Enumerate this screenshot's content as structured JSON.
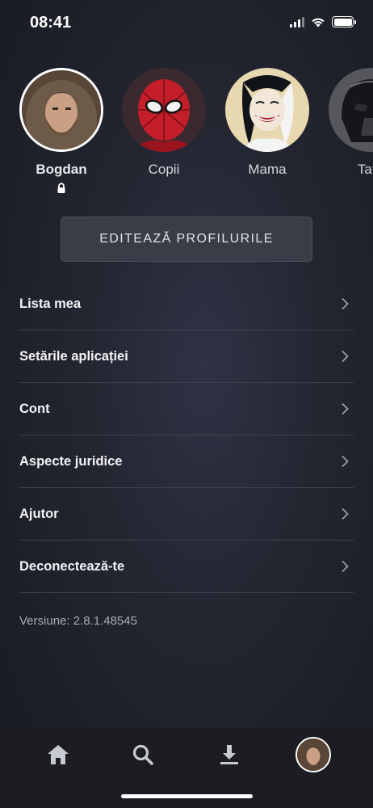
{
  "status": {
    "time": "08:41"
  },
  "profiles": [
    {
      "name": "Bogdan",
      "locked": true,
      "active": true
    },
    {
      "name": "Copii",
      "locked": false,
      "active": false
    },
    {
      "name": "Mama",
      "locked": false,
      "active": false
    },
    {
      "name": "Tata",
      "locked": false,
      "active": false
    }
  ],
  "edit_profiles_label": "EDITEAZĂ PROFILURILE",
  "menu": [
    {
      "label": "Lista mea"
    },
    {
      "label": "Setările aplicației"
    },
    {
      "label": "Cont"
    },
    {
      "label": "Aspecte juridice"
    },
    {
      "label": "Ajutor"
    },
    {
      "label": "Deconectează-te"
    }
  ],
  "version_text": "Versiune: 2.8.1.48545",
  "tab_bar": {
    "tabs": [
      "home-icon",
      "search-icon",
      "download-icon",
      "profile-avatar"
    ]
  },
  "colors": {
    "background": "#22252f",
    "button_bg": "#3a3d47",
    "divider": "#3e414c",
    "tab_bar": "#1c1d22"
  }
}
